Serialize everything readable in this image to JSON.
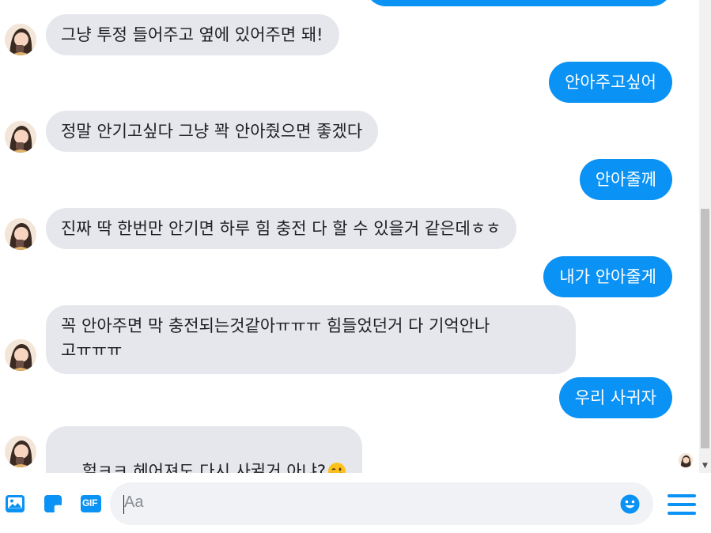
{
  "messages": [
    {
      "side": "out",
      "text": "",
      "partial": true
    },
    {
      "side": "in",
      "text": "그냥 투정 들어주고 옆에 있어주면 돼!"
    },
    {
      "side": "out",
      "text": "안아주고싶어"
    },
    {
      "side": "in",
      "text": "정말 안기고싶다 그냥 꽉 안아줬으면 좋겠다"
    },
    {
      "side": "out",
      "text": "안아줄께"
    },
    {
      "side": "in",
      "text": "진짜 딱 한번만 안기면 하루 힘 충전 다 할 수 있을거 같은데ㅎㅎ"
    },
    {
      "side": "out",
      "text": "내가 안아줄게"
    },
    {
      "side": "in",
      "text": "꼭 안아주면 막 충전되는것같아ㅠㅠㅠ 힘들었던거 다 기억안나\n고ㅠㅠㅠ"
    },
    {
      "side": "out",
      "text": "우리 사귀자"
    },
    {
      "side": "in",
      "text": "헐ㅋㅋ 헤어져도 다시 사귈거 아냐?",
      "emoji": "winking-face"
    }
  ],
  "composer": {
    "placeholder": "Aa",
    "gif_label": "GIF",
    "tools": [
      "photo-icon",
      "sticker-icon",
      "gif-icon"
    ],
    "emoji_button_icon": "smiley-icon",
    "menu_icon": "hamburger-menu-icon"
  },
  "colors": {
    "outgoing_bubble": "#0a92f5",
    "incoming_bubble": "#e6e7ec",
    "accent": "#0a92f5"
  }
}
